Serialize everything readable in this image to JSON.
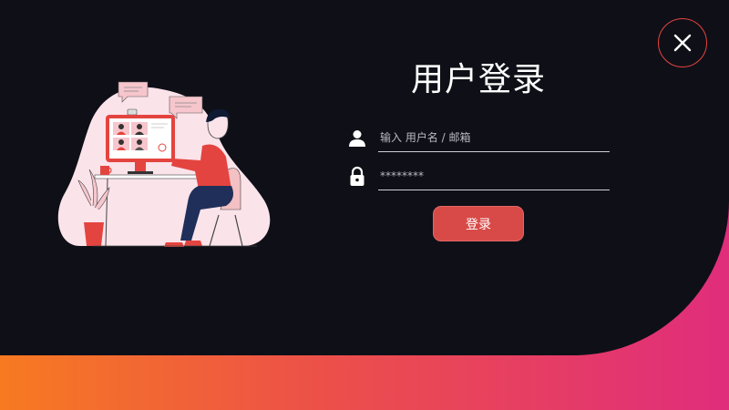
{
  "login": {
    "title": "用户登录",
    "username_placeholder": "输入 用户名 / 邮箱",
    "password_mask": "********",
    "submit_label": "登录"
  },
  "icons": {
    "close": "close-icon",
    "user": "user-icon",
    "lock": "lock-icon"
  },
  "colors": {
    "panel_background": "#0f0f17",
    "accent_red": "#d84a47",
    "gradient_start": "#f77a21",
    "gradient_end": "#e02d7c"
  }
}
